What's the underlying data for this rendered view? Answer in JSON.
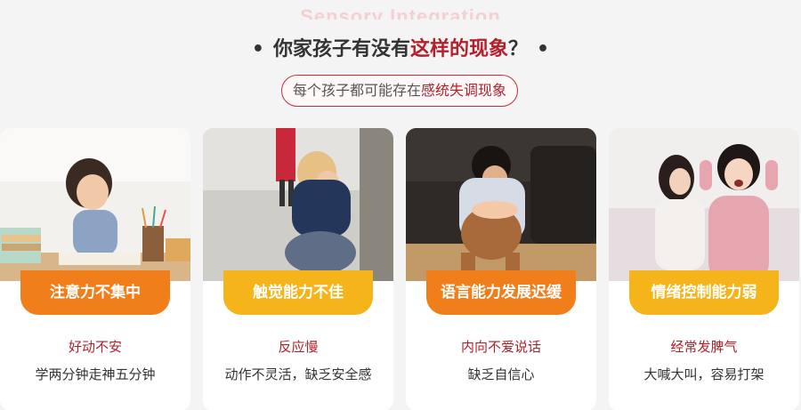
{
  "watermark": "Sensory Integration",
  "heading": {
    "prefix": "你家孩子有没有",
    "highlight": "这样的现象",
    "suffix": "？"
  },
  "subtitle": {
    "prefix": "每个孩子都可能存在",
    "highlight": "感统失调现象"
  },
  "colors": {
    "accent_red": "#b2202b",
    "badge_orange": "#f07e1b",
    "badge_yellow": "#f5b41a"
  },
  "cards": [
    {
      "badge": "注意力不集中",
      "line1": "好动不安",
      "line2": "学两分钟走神五分钟"
    },
    {
      "badge": "触觉能力不佳",
      "line1": "反应慢",
      "line2": "动作不灵活，缺乏安全感"
    },
    {
      "badge": "语言能力发展迟缓",
      "line1": "内向不爱说话",
      "line2": "缺乏自信心"
    },
    {
      "badge": "情绪控制能力弱",
      "line1": "经常发脾气",
      "line2": "大喊大叫，容易打架"
    }
  ]
}
